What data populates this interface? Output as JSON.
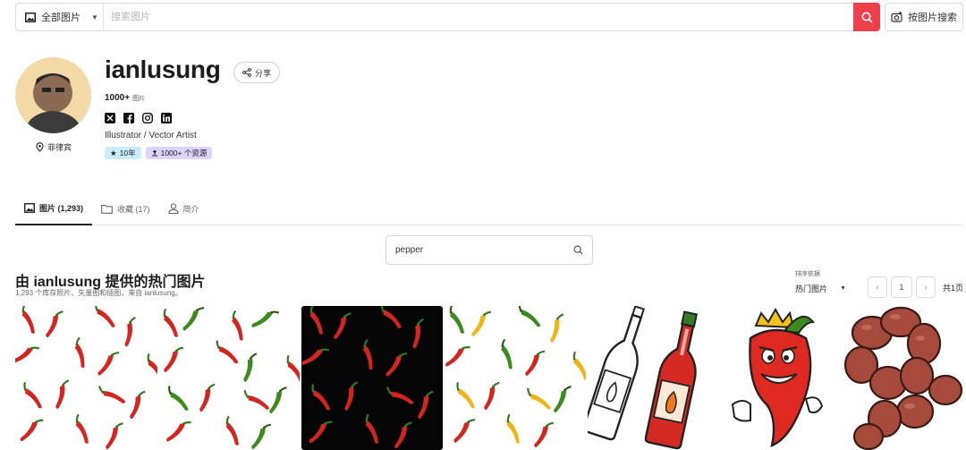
{
  "search": {
    "category": "全部图片",
    "placeholder": "搜索图片",
    "image_search": "按图片搜索"
  },
  "profile": {
    "username": "ianlusung",
    "share": "分享",
    "count_bold": "1000+",
    "count_unit": "图片",
    "location": "菲律宾",
    "title": "Illustrator / Vector Artist",
    "badge_years": "10年",
    "badge_resources": "1000+ 个资源",
    "socials": [
      "x-icon",
      "facebook-icon",
      "instagram-icon",
      "linkedin-icon"
    ]
  },
  "tabs": [
    {
      "label": "图片 (1,293)",
      "icon": "image-icon"
    },
    {
      "label": "收藏 (17)",
      "icon": "folder-icon"
    },
    {
      "label": "简介",
      "icon": "user-icon"
    }
  ],
  "inner_search": {
    "value": "pepper"
  },
  "section": {
    "title": "由 ianlusung 提供的热门图片",
    "subtitle": "1,293 个库存照片、矢量图和插图，来自 ianlusung。"
  },
  "sort": {
    "label": "排序依据",
    "value": "热门图片"
  },
  "pager": {
    "page": "1",
    "total": "共1页"
  },
  "gallery": [
    {
      "name": "chili-pattern-white"
    },
    {
      "name": "chili-pattern-red-green"
    },
    {
      "name": "chili-pattern-black"
    },
    {
      "name": "chili-pattern-yellow-green"
    },
    {
      "name": "hot-sauce-bottles"
    },
    {
      "name": "chili-mascot"
    },
    {
      "name": "sausage-links"
    }
  ],
  "colors": {
    "accent": "#ee3f4a",
    "badge_blue": "#c9ecfb",
    "badge_purple": "#ded3fb"
  }
}
